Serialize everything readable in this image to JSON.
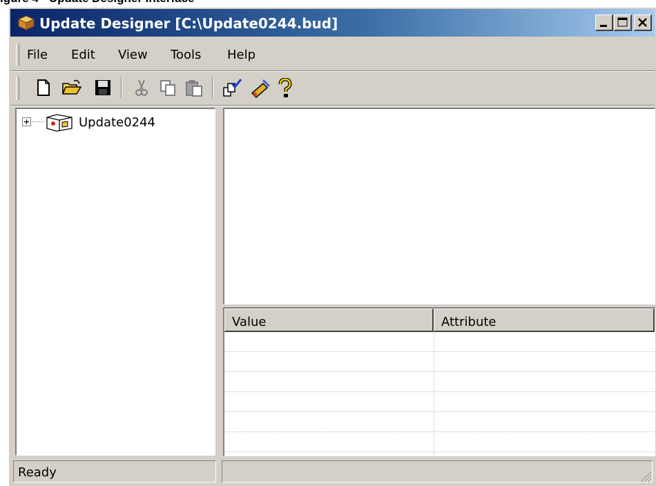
{
  "caption": "igure 4 - Update Designer Interface",
  "window": {
    "title": "Update Designer [C:\\Update0244.bud]",
    "app_icon": "package-icon",
    "controls": [
      "minimize-icon",
      "maximize-icon",
      "close-icon"
    ]
  },
  "menu": {
    "items": [
      {
        "label": "File"
      },
      {
        "label": "Edit"
      },
      {
        "label": "View"
      },
      {
        "label": "Tools"
      },
      {
        "label": "Help"
      }
    ]
  },
  "toolbar": {
    "buttons": [
      {
        "icon": "new-file-icon",
        "enabled": true
      },
      {
        "icon": "open-folder-icon",
        "enabled": true
      },
      {
        "icon": "save-icon",
        "enabled": true
      },
      {
        "icon": "cut-icon",
        "enabled": false
      },
      {
        "icon": "copy-icon",
        "enabled": false
      },
      {
        "icon": "paste-icon",
        "enabled": false
      },
      {
        "icon": "check-icon",
        "enabled": true
      },
      {
        "icon": "build-icon",
        "enabled": true
      },
      {
        "icon": "help-icon",
        "enabled": true
      }
    ]
  },
  "tree": {
    "root": {
      "label": "Update0244",
      "expander": "+",
      "icon": "package-node-icon"
    }
  },
  "grid": {
    "columns": [
      "Value",
      "Attribute"
    ],
    "rows": 6
  },
  "status": {
    "text": "Ready"
  },
  "colors": {
    "title_gradient_start": "#0a246a",
    "title_gradient_end": "#a6caf0",
    "chrome": "#d4d0c8"
  }
}
